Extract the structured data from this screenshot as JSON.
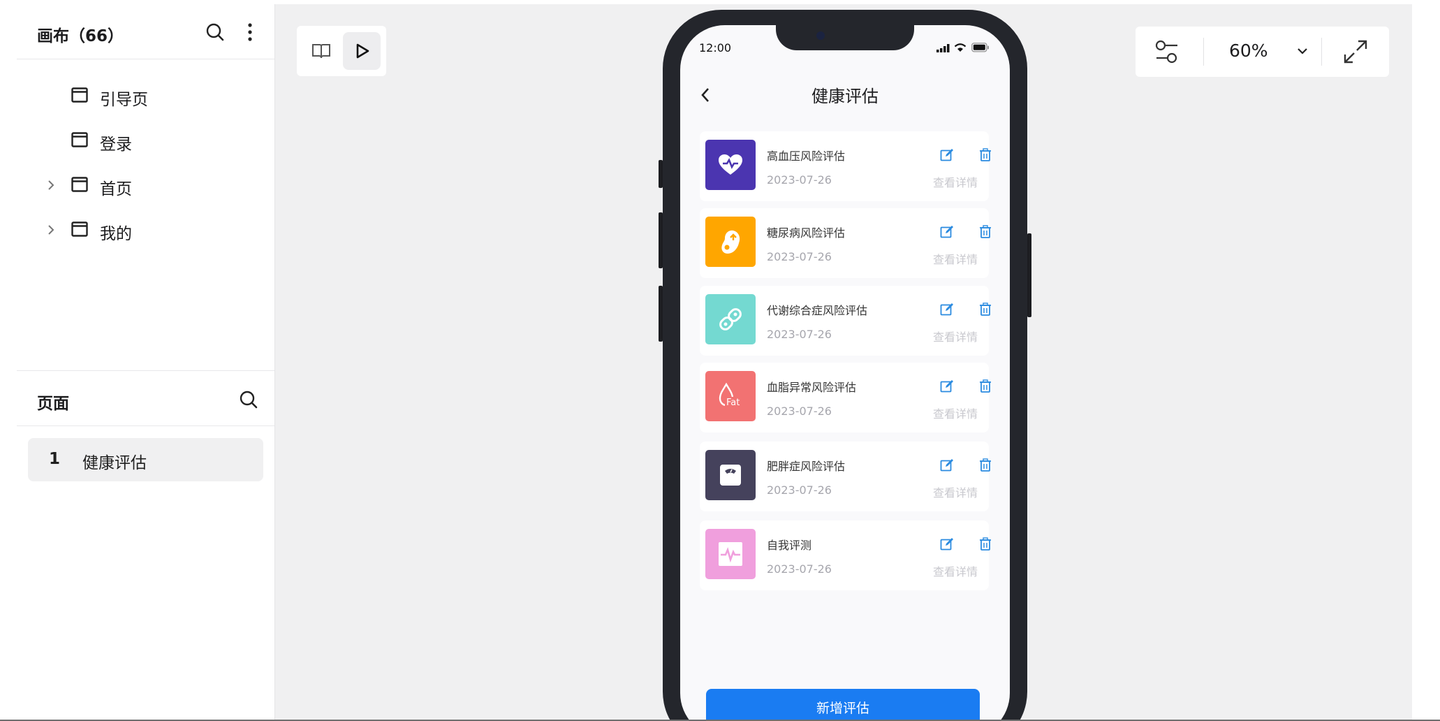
{
  "sidebar": {
    "canvas_title": "画布（66）",
    "tree": [
      {
        "label": "引导页",
        "expandable": false
      },
      {
        "label": "登录",
        "expandable": false
      },
      {
        "label": "首页",
        "expandable": true
      },
      {
        "label": "我的",
        "expandable": true
      }
    ],
    "pages_title": "页面",
    "pages": [
      {
        "number": "1",
        "label": "健康评估",
        "selected": true
      }
    ]
  },
  "toolbar": {
    "zoom": "60%",
    "icons": [
      "book-icon",
      "play-icon",
      "settings-sliders-icon",
      "chevron-down-icon",
      "expand-icon"
    ]
  },
  "phone": {
    "status_time": "12:00",
    "nav_title": "健康评估",
    "items": [
      {
        "name": "高血压风险评估",
        "date": "2023-07-26",
        "detail": "查看详情",
        "color": "#4b35b0",
        "icon": "heart-pulse-icon"
      },
      {
        "name": "糖尿病风险评估",
        "date": "2023-07-26",
        "detail": "查看详情",
        "color": "#ffa600",
        "icon": "pancreas-icon"
      },
      {
        "name": "代谢综合症风险评估",
        "date": "2023-07-26",
        "detail": "查看详情",
        "color": "#74d9d1",
        "icon": "link-chain-icon"
      },
      {
        "name": "血脂异常风险评估",
        "date": "2023-07-26",
        "detail": "查看详情",
        "color": "#f27272",
        "icon": "fat-drop-icon"
      },
      {
        "name": "肥胖症风险评估",
        "date": "2023-07-26",
        "detail": "查看详情",
        "color": "#45425c",
        "icon": "scale-icon"
      },
      {
        "name": "自我评测",
        "date": "2023-07-26",
        "detail": "查看详情",
        "color": "#f09fdd",
        "icon": "pulse-chart-icon"
      }
    ],
    "add_button": "新增评估"
  },
  "colors": {
    "accent": "#1a7cf2",
    "edit_icon": "#2b8be0"
  }
}
